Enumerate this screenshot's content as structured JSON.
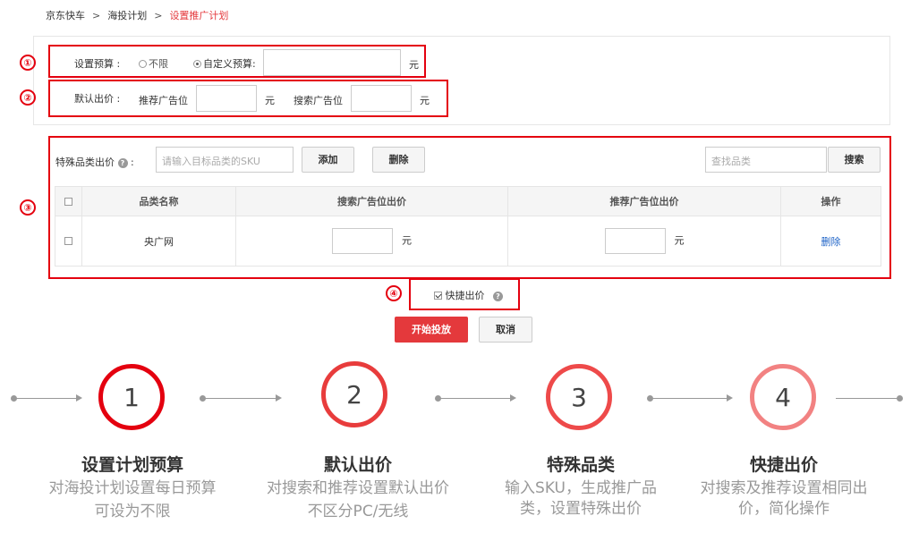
{
  "breadcrumb": {
    "items": [
      "京东快车",
      "海投计划"
    ],
    "separator": ">",
    "current": "设置推广计划"
  },
  "markers": [
    "①",
    "②",
    "③",
    "④"
  ],
  "budget": {
    "label": "设置预算 :",
    "option_unlimited": "不限",
    "option_custom": "自定义预算:",
    "selected": "custom",
    "value": "",
    "unit": "元"
  },
  "bid": {
    "label": "默认出价 :",
    "recommend_label": "推荐广告位",
    "recommend_value": "",
    "unit1": "元",
    "search_label": "搜索广告位",
    "search_value": "",
    "unit2": "元"
  },
  "special": {
    "label": "特殊品类出价",
    "colon": ":",
    "sku_placeholder": "请输入目标品类的SKU",
    "add_btn": "添加",
    "del_btn": "删除",
    "find_placeholder": "查找品类",
    "search_btn": "搜索"
  },
  "table": {
    "headers": [
      "品类名称",
      "搜索广告位出价",
      "推荐广告位出价",
      "操作"
    ],
    "rows": [
      {
        "name": "央广网",
        "search_unit": "元",
        "rec_unit": "元",
        "action": "删除"
      }
    ]
  },
  "quick": {
    "label": "快捷出价",
    "checked": true
  },
  "actions": {
    "start": "开始投放",
    "cancel": "取消"
  },
  "steps": [
    {
      "num": "1",
      "title": "设置计划预算",
      "desc1": "对海投计划设置每日预算",
      "desc2": "可设为不限",
      "color": "#e4000f"
    },
    {
      "num": "2",
      "title": "默认出价",
      "desc1": "对搜索和推荐设置默认出价",
      "desc2": "不区分PC/无线",
      "color": "#e83c3c"
    },
    {
      "num": "3",
      "title": "特殊品类",
      "desc1": "输入SKU，生成推广品",
      "desc2": "类，设置特殊出价",
      "color": "#ee4a4a"
    },
    {
      "num": "4",
      "title": "快捷出价",
      "desc1": "对搜索及推荐设置相同出",
      "desc2": "价，简化操作",
      "color": "#f28282"
    }
  ],
  "colors": {
    "accent": "#e4393c",
    "marker": "#e4000f",
    "link": "#1e63c7"
  }
}
